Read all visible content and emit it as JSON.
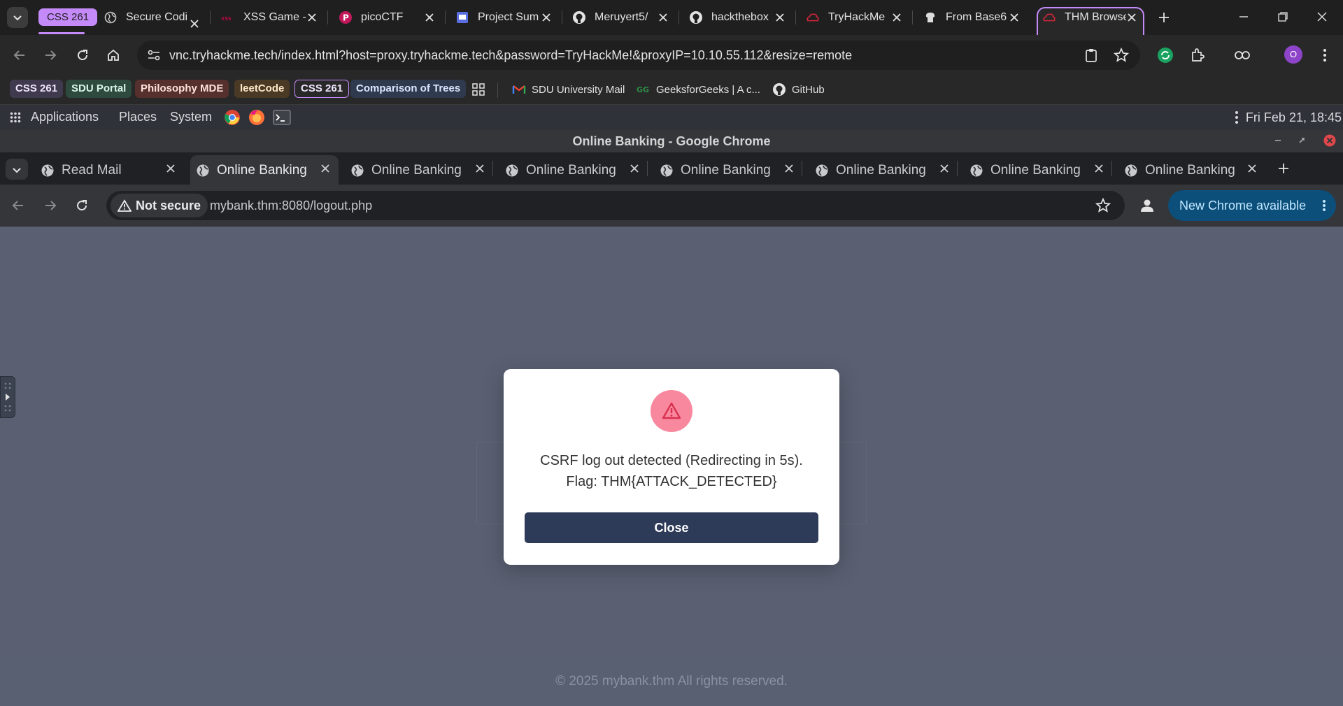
{
  "outer_chrome": {
    "tab_group_label": "CSS 261",
    "tabs": [
      {
        "title": "Secure Codi",
        "icon": "globe-icon"
      },
      {
        "title": "XSS Game -",
        "icon": "xss-game-icon"
      },
      {
        "title": "picoCTF",
        "icon": "picoctf-icon"
      },
      {
        "title": "Project Sum",
        "icon": "slides-icon"
      },
      {
        "title": "Meruyert5/",
        "icon": "github-icon"
      },
      {
        "title": "hackthebox",
        "icon": "github-icon"
      },
      {
        "title": "TryHackMe",
        "icon": "tryhackme-icon"
      },
      {
        "title": "From Base6",
        "icon": "cyberchef-icon"
      },
      {
        "title": "THM Browse",
        "icon": "tryhackme-icon"
      }
    ],
    "url": "vnc.tryhackme.tech/index.html?host=proxy.tryhackme.tech&password=TryHackMe!&proxyIP=10.10.55.112&resize=remote",
    "profile_initial": "O",
    "bookmarks": {
      "chips": [
        "CSS 261",
        "SDU Portal",
        "Philosophy MDE",
        "leetCode",
        "CSS 261",
        "Comparison of Trees"
      ],
      "links": [
        "SDU University Mail",
        "GeeksforGeeks | A c...",
        "GitHub"
      ]
    }
  },
  "desktop": {
    "menus": [
      "Applications",
      "Places",
      "System"
    ],
    "clock": "Fri Feb 21, 18:45",
    "window_title": "Online Banking - Google Chrome"
  },
  "inner_chrome": {
    "tabs": [
      "Read Mail",
      "Online Banking",
      "Online Banking",
      "Online Banking",
      "Online Banking",
      "Online Banking",
      "Online Banking",
      "Online Banking"
    ],
    "security_label": "Not secure",
    "url": "mybank.thm:8080/logout.php",
    "update_label": "New Chrome available"
  },
  "page": {
    "modal": {
      "line1": "CSRF log out detected (Redirecting in 5s).",
      "line2": "Flag: THM{ATTACK_DETECTED}",
      "close_label": "Close"
    },
    "footer": "© 2025 mybank.thm All rights reserved."
  },
  "colors": {
    "tab_group": "#c58af9",
    "overlay_bg": "#5a6072",
    "warn": "#f8889e",
    "warn_icon": "#d9304f",
    "button": "#2d3a58",
    "update_pill": "#0b4f7a"
  }
}
